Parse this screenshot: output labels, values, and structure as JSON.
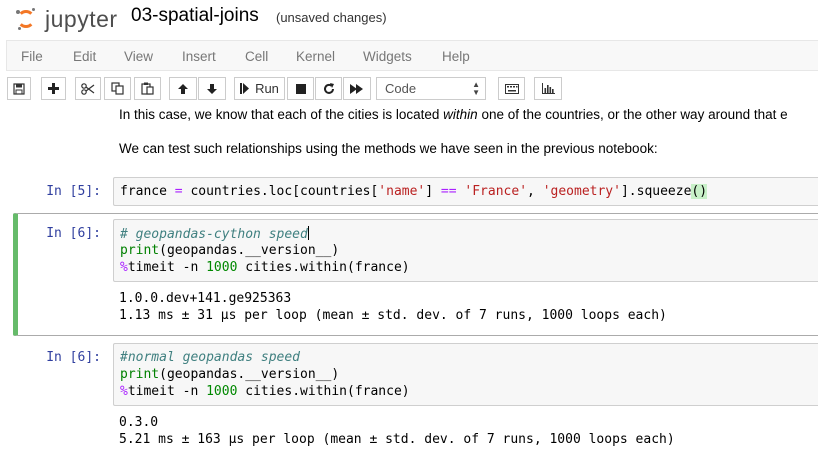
{
  "header": {
    "logo_text": "jupyter",
    "notebook_name": "03-spatial-joins",
    "save_status": "(unsaved changes)"
  },
  "menu": [
    "File",
    "Edit",
    "View",
    "Insert",
    "Cell",
    "Kernel",
    "Widgets",
    "Help"
  ],
  "toolbar": {
    "run_label": "Run",
    "cell_type": "Code",
    "icons": [
      "save-icon",
      "plus-icon",
      "cut-icon",
      "copy-icon",
      "paste-icon",
      "arrow-up-icon",
      "arrow-down-icon",
      "step-forward-icon",
      "stop-icon",
      "restart-icon",
      "fast-forward-icon",
      "keyboard-icon",
      "chart-icon"
    ]
  },
  "markdown": {
    "line1_pre": "In this case, we know that each of the cities is located ",
    "line1_em": "within",
    "line1_post": " one of the countries, or the other way around that e",
    "line2": "We can test such relationships using the methods we have seen in the previous notebook:"
  },
  "cells": [
    {
      "prompt": "In [5]:",
      "code": {
        "a": "france",
        "b": " = ",
        "c": "countries.loc[countries[",
        "d": "'name'",
        "e": "] ",
        "f": "==",
        "g": " ",
        "h": "'France'",
        "i": ", ",
        "j": "'geometry'",
        "k": "].squeeze",
        "l": "()"
      }
    },
    {
      "prompt": "In [6]:",
      "code_lines": {
        "comment": "# geopandas-cython speed",
        "print_kw": "print",
        "print_rest": "(geopandas.__version__)",
        "magic_sym": "%",
        "magic_rest": "timeit -n ",
        "magic_num": "1000",
        "magic_tail": " cities.within(france)"
      },
      "output": [
        "1.0.0.dev+141.ge925363",
        "1.13 ms ± 31 µs per loop (mean ± std. dev. of 7 runs, 1000 loops each)"
      ]
    },
    {
      "prompt": "In [6]:",
      "code_lines": {
        "comment": "#normal geopandas speed",
        "print_kw": "print",
        "print_rest": "(geopandas.__version__)",
        "magic_sym": "%",
        "magic_rest": "timeit -n ",
        "magic_num": "1000",
        "magic_tail": " cities.within(france)"
      },
      "output": [
        "0.3.0",
        "5.21 ms ± 163 µs per loop (mean ± std. dev. of 7 runs, 1000 loops each)"
      ]
    }
  ],
  "colors": {
    "prompt": "#303f9f",
    "selected_border": "#66bb6a",
    "logo_orange": "#f37726"
  }
}
